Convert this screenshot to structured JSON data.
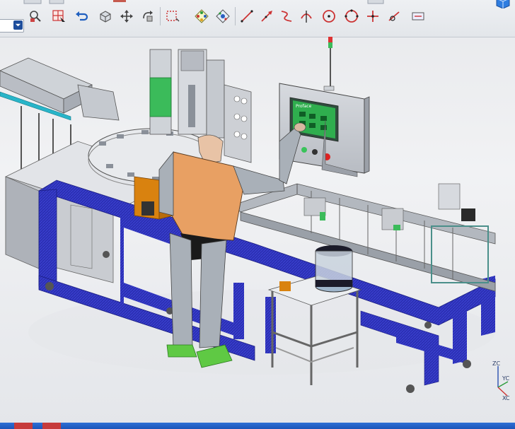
{
  "window": {
    "title": ""
  },
  "toolbar": {
    "buttons": [
      {
        "name": "filter-combo"
      },
      {
        "name": "select-filter-icon"
      },
      {
        "name": "pick-snap-icon"
      },
      {
        "name": "undo-icon"
      },
      {
        "name": "view-orient-icon"
      },
      {
        "name": "move-component-icon"
      },
      {
        "name": "rotate-component-icon"
      },
      {
        "name": "box-select-icon"
      },
      {
        "name": "snap-points-icon"
      },
      {
        "name": "snap-midpoint-icon"
      },
      {
        "name": "line-icon"
      },
      {
        "name": "line-arrow-icon"
      },
      {
        "name": "spline-icon"
      },
      {
        "name": "intersection-icon"
      },
      {
        "name": "circle-center-icon"
      },
      {
        "name": "circle-points-icon"
      },
      {
        "name": "cross-icon"
      },
      {
        "name": "tangent-icon"
      }
    ],
    "accent_color": "#1e4e9c"
  },
  "viewport": {
    "hmi_label": "Proface",
    "triad_labels": {
      "z": "ZC",
      "y": "YC",
      "x": "XC"
    },
    "colors": {
      "frame": "#2b2fb3",
      "mannequin_torso": "#e8a063",
      "mannequin_limbs": "#a9b0b8",
      "shoes": "#5fc944",
      "conveyor": "#9aa0a8",
      "panel": "#c9ccd1",
      "screen": "#2fae4e"
    }
  },
  "taskbar": {
    "color": "#1f5bbf"
  }
}
